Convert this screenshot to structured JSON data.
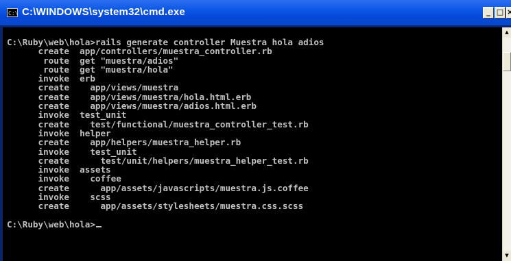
{
  "window": {
    "title": "C:\\WINDOWS\\system32\\cmd.exe",
    "icon_name": "cmd-icon",
    "icon_glyph": "C:\\"
  },
  "controls": {
    "minimize": "_",
    "maximize": "□",
    "close": "×"
  },
  "scrollbar": {
    "up_glyph": "▲",
    "down_glyph": "▼"
  },
  "console": {
    "lines": [
      "C:\\Ruby\\web\\hola>rails generate controller Muestra hola adios",
      "      create  app/controllers/muestra_controller.rb",
      "       route  get \"muestra/adios\"",
      "       route  get \"muestra/hola\"",
      "      invoke  erb",
      "      create    app/views/muestra",
      "      create    app/views/muestra/hola.html.erb",
      "      create    app/views/muestra/adios.html.erb",
      "      invoke  test_unit",
      "      create    test/functional/muestra_controller_test.rb",
      "      invoke  helper",
      "      create    app/helpers/muestra_helper.rb",
      "      invoke    test_unit",
      "      create      test/unit/helpers/muestra_helper_test.rb",
      "      invoke  assets",
      "      invoke    coffee",
      "      create      app/assets/javascripts/muestra.js.coffee",
      "      invoke    scss",
      "      create      app/assets/stylesheets/muestra.css.scss",
      "",
      "C:\\Ruby\\web\\hola>"
    ]
  },
  "colors": {
    "title_bar": "#0a56e6",
    "console_bg": "#000000",
    "console_fg": "#c0c0c0"
  }
}
